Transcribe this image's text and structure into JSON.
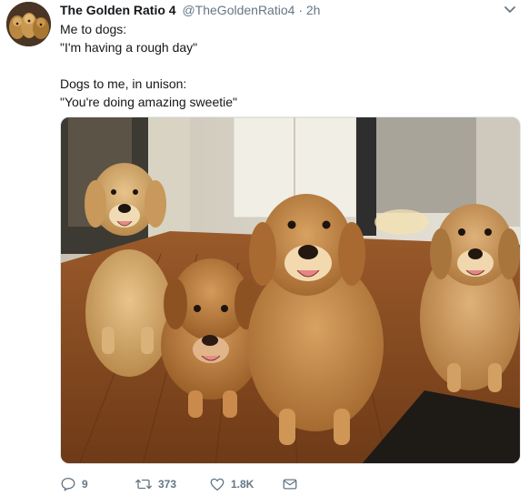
{
  "tweet": {
    "display_name": "The Golden Ratio 4",
    "handle": "@TheGoldenRatio4",
    "separator": "·",
    "time": "2h",
    "lines": [
      "Me to dogs:",
      "\"I'm having a rough day\"",
      "",
      "Dogs to me, in unison:",
      "\"You're doing amazing sweetie\""
    ],
    "photo_icon": "photo-of-four-golden-retrievers"
  },
  "actions": {
    "replies": "9",
    "retweets": "373",
    "likes": "1.8K"
  },
  "icons": {
    "reply": "reply-icon",
    "retweet": "retweet-icon",
    "like": "heart-icon",
    "dm": "envelope-icon",
    "menu": "chevron-down-icon"
  },
  "colors": {
    "text": "#14171a",
    "secondary": "#657786"
  }
}
